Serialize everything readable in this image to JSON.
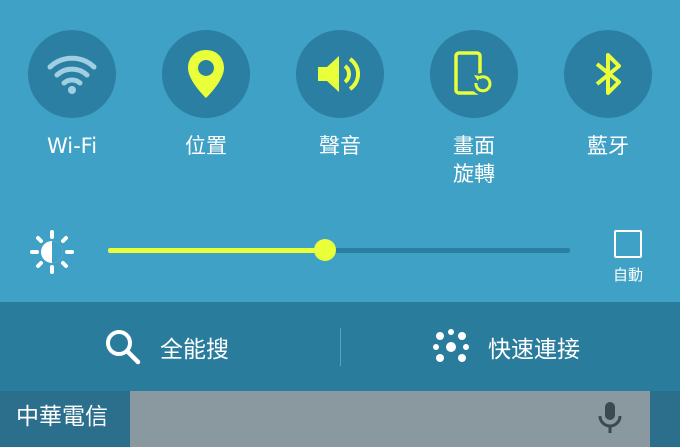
{
  "toggles": [
    {
      "label": "Wi-Fi",
      "icon": "wifi-icon"
    },
    {
      "label": "位置",
      "icon": "location-pin-icon"
    },
    {
      "label": "聲音",
      "icon": "sound-icon"
    },
    {
      "label": "畫面\n旋轉",
      "icon": "screen-rotation-icon"
    },
    {
      "label": "藍牙",
      "icon": "bluetooth-icon"
    }
  ],
  "brightness": {
    "level": 0.47,
    "auto_label": "自動",
    "auto_checked": false
  },
  "bottom_bar": {
    "search_label": "全能搜",
    "quick_connect_label": "快速連接"
  },
  "status": {
    "carrier": "中華電信"
  },
  "colors": {
    "accent": "#e8ff3a",
    "panel": "#3fa1c5",
    "circle": "#2a7fa3",
    "bar": "#2a7c9c"
  }
}
